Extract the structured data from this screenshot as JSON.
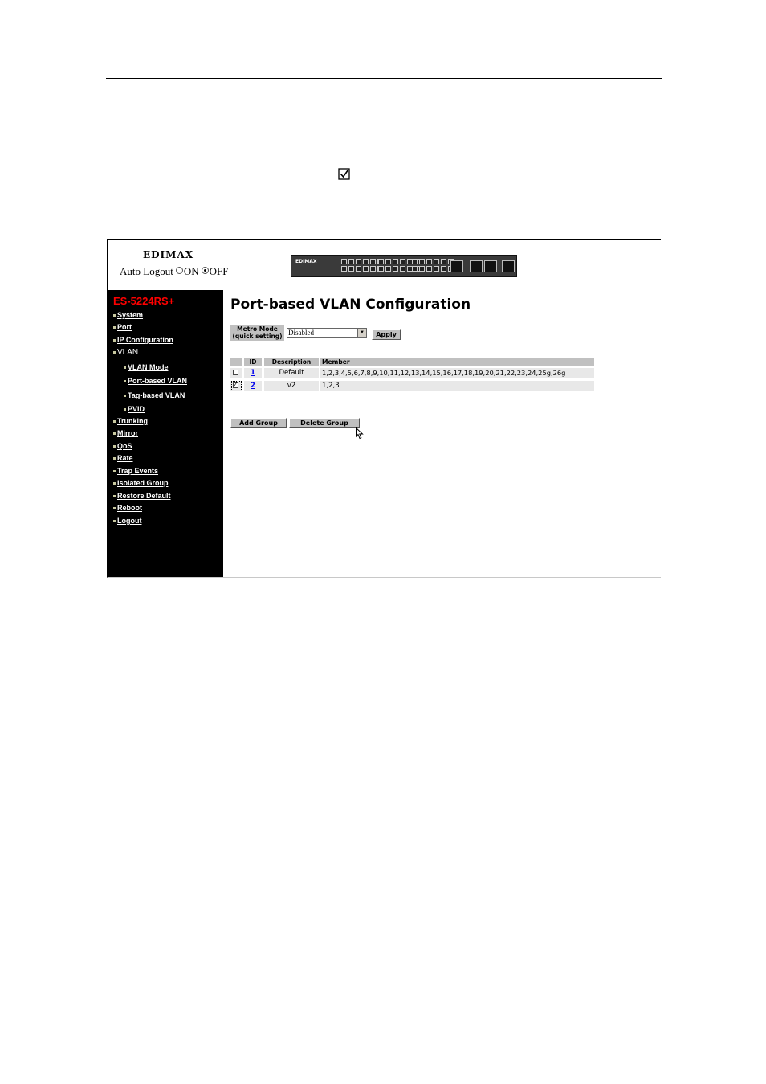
{
  "header": {
    "logo": "EDIMAX",
    "auto_logout_label": "Auto Logout",
    "on_label": "ON",
    "off_label": "OFF",
    "auto_logout_selected": "OFF",
    "device_logo": "EDIMAX"
  },
  "sidebar": {
    "model": "ES-5224RS+",
    "items": [
      {
        "label": "System"
      },
      {
        "label": "Port"
      },
      {
        "label": "IP Configuration"
      },
      {
        "label": "VLAN"
      },
      {
        "label": "VLAN Mode"
      },
      {
        "label": "Port-based VLAN"
      },
      {
        "label": "Tag-based VLAN"
      },
      {
        "label": "PVID"
      },
      {
        "label": "Trunking"
      },
      {
        "label": "Mirror"
      },
      {
        "label": "QoS"
      },
      {
        "label": "Rate"
      },
      {
        "label": "Trap Events"
      },
      {
        "label": "Isolated Group"
      },
      {
        "label": "Restore Default"
      },
      {
        "label": "Reboot"
      },
      {
        "label": "Logout"
      }
    ]
  },
  "main": {
    "title": "Port-based VLAN Configuration",
    "metro_mode": {
      "label_line1": "Metro Mode",
      "label_line2": "(quick setting)",
      "value": "Disabled",
      "apply_label": "Apply"
    },
    "table": {
      "headers": [
        "ID",
        "Description",
        "Member"
      ],
      "rows": [
        {
          "checked": false,
          "id": "1",
          "description": "Default",
          "member": "1,2,3,4,5,6,7,8,9,10,11,12,13,14,15,16,17,18,19,20,21,22,23,24,25g,26g"
        },
        {
          "checked": true,
          "id": "2",
          "description": "v2",
          "member": "1,2,3"
        }
      ]
    },
    "add_group_label": "Add Group",
    "delete_group_label": "Delete Group"
  }
}
